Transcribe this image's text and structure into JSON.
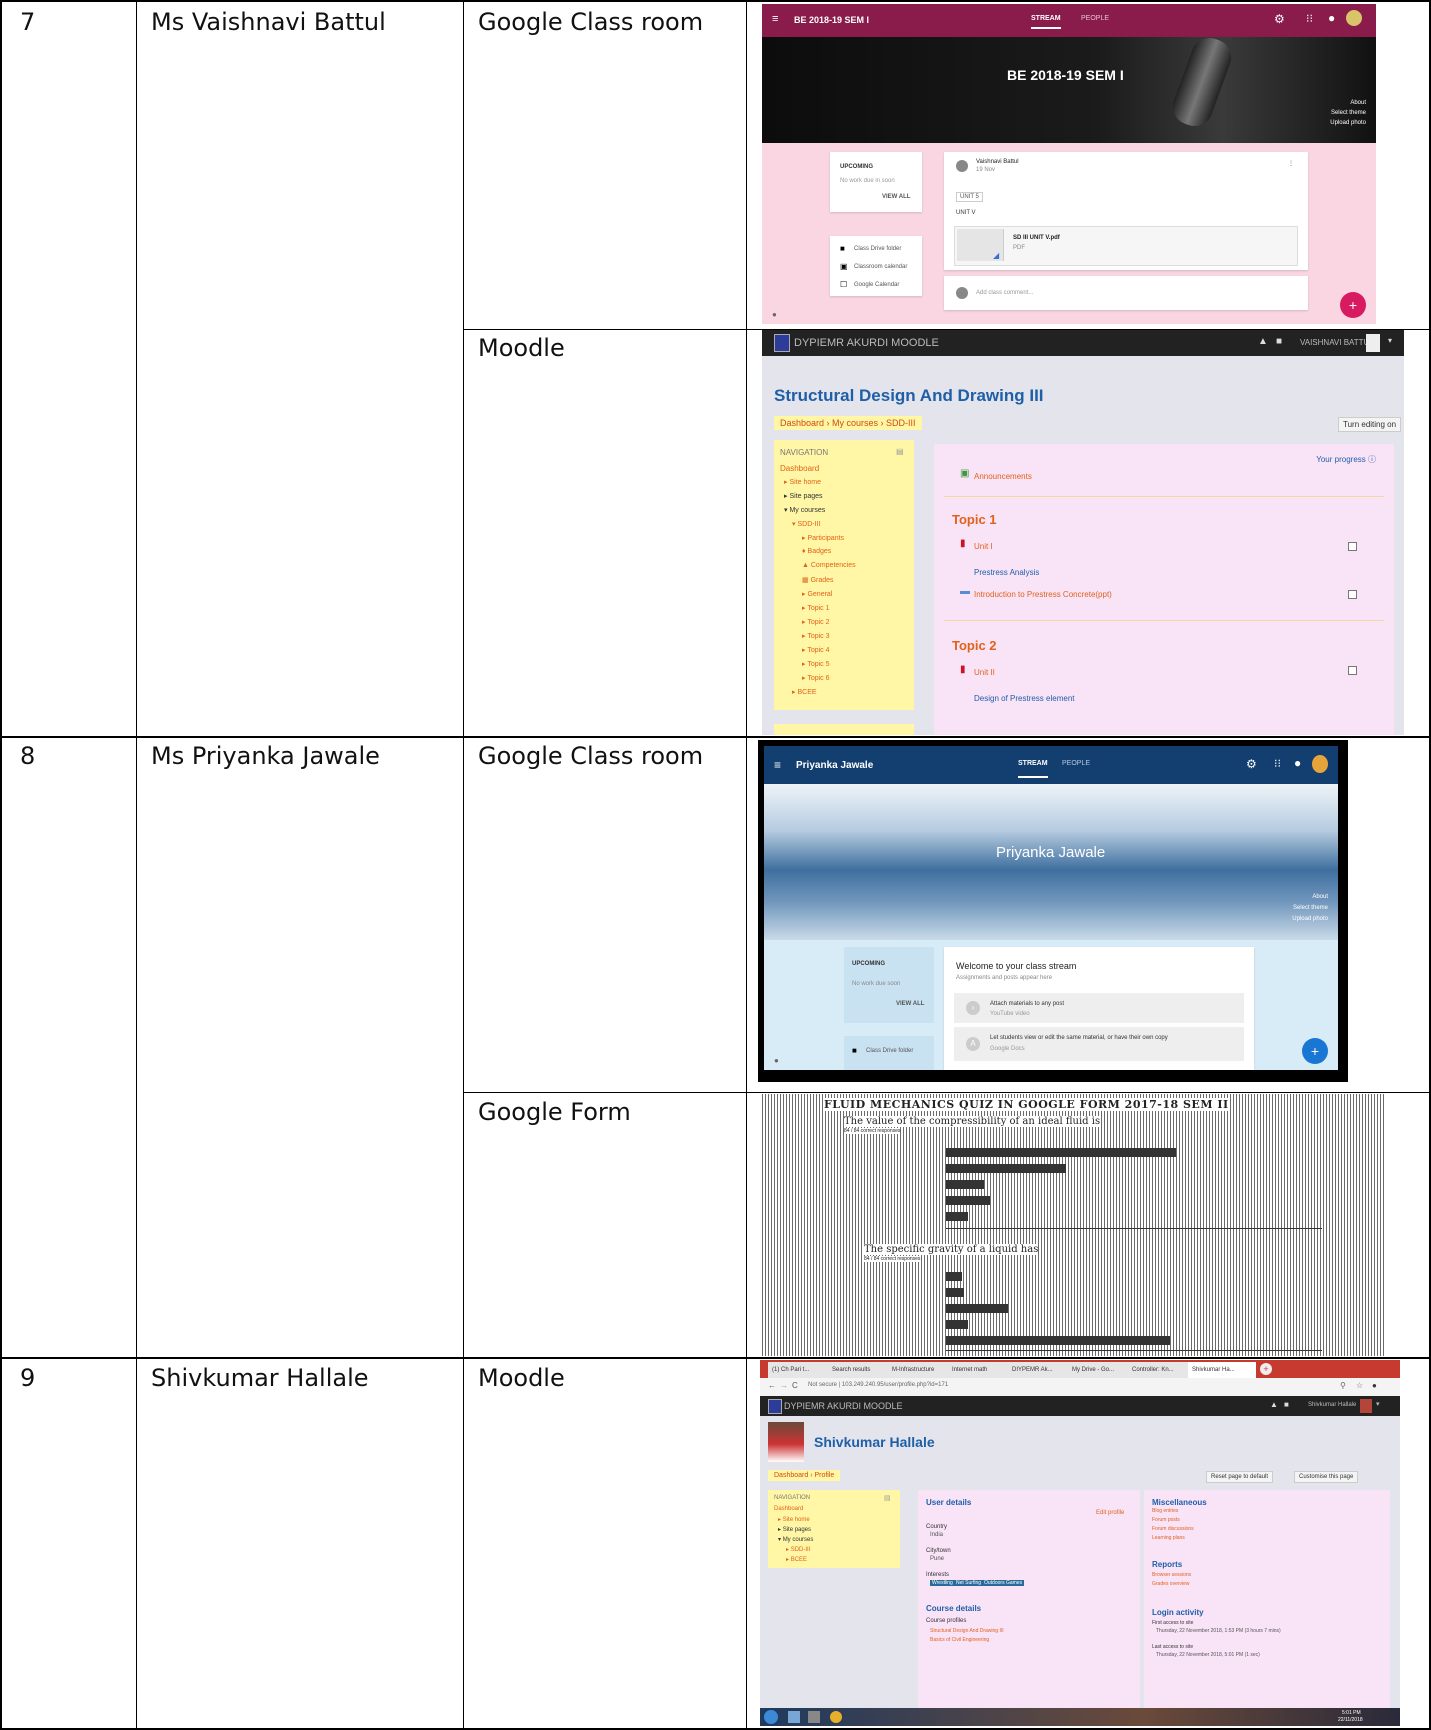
{
  "rows": [
    {
      "no": "7",
      "name": "Ms Vaishnavi Battul",
      "tools": [
        "Google Class room",
        "Moodle"
      ]
    },
    {
      "no": "8",
      "name": "Ms Priyanka Jawale",
      "tools": [
        "Google Class room",
        "Google Form"
      ]
    },
    {
      "no": "9",
      "name": "Shivkumar Hallale",
      "tools": [
        "Moodle"
      ]
    }
  ],
  "gc1": {
    "title": "BE 2018-19 SEM I",
    "tab_stream": "STREAM",
    "tab_people": "PEOPLE",
    "banner_title": "BE 2018-19 SEM I",
    "about": "About",
    "select_theme": "Select theme",
    "upload_photo": "Upload photo",
    "upcoming": "UPCOMING",
    "no_work": "No work due in soon",
    "view_all": "VIEW ALL",
    "drive": "Class Drive folder",
    "calendar": "Classroom calendar",
    "gcal": "Google Calendar",
    "poster": "Vaishnavi Battul",
    "post_time": "19 Nov",
    "unit_chip": "UNIT 5",
    "unit_text": "UNIT V",
    "file_name": "SD III UNIT V.pdf",
    "file_type": "PDF",
    "add_comment": "Add class comment..."
  },
  "moodle1": {
    "site": "DYPIEMR AKURDI MOODLE",
    "user": "VAISHNAVI BATTUL",
    "course_title": "Structural Design And Drawing III",
    "breadcrumb": "Dashboard  ›  My courses  ›  SDD-III",
    "turn_editing": "Turn editing on",
    "nav_heading": "NAVIGATION",
    "nav": [
      "Dashboard",
      "Site home",
      "Site pages",
      "My courses",
      "SDD-III",
      "Participants",
      "Badges",
      "Competencies",
      "Grades",
      "General",
      "Topic 1",
      "Topic 2",
      "Topic 3",
      "Topic 4",
      "Topic 5",
      "Topic 6",
      "BCEE"
    ],
    "progress": "Your progress",
    "announcements": "Announcements",
    "topic1": "Topic 1",
    "unit1": "Unit I",
    "unit1_desc": "Prestress Analysis",
    "intro": "Introduction to Prestress Concrete(ppt)",
    "topic2": "Topic 2",
    "unit2": "Unit II",
    "unit2_desc": "Design of Prestress element"
  },
  "gc2": {
    "title": "Priyanka Jawale",
    "tab_stream": "STREAM",
    "tab_people": "PEOPLE",
    "banner_title": "Priyanka Jawale",
    "about": "About",
    "select_theme": "Select theme",
    "upload_photo": "Upload photo",
    "upcoming": "UPCOMING",
    "no_work": "No work due soon",
    "view_all": "VIEW ALL",
    "drive": "Class Drive folder",
    "welcome": "Welcome to your class stream",
    "welcome_sub": "Assignments and posts appear here",
    "tip1": "Attach materials to any post",
    "tip1_sub": "YouTube video",
    "tip2": "Let students view or edit the same material, or have their own copy",
    "tip2_sub": "Google Docs"
  },
  "gform": {
    "title": "FLUID MECHANICS QUIZ IN GOOGLE FORM 2017-18 SEM II",
    "q1": "The value of the compressibility of an ideal fluid is",
    "q1_sub": "84 / 84 correct responses",
    "q2": "The specific gravity of a liquid has",
    "q2_sub": "84 / 84 correct responses"
  },
  "moodle2": {
    "tabs": [
      "(1) Ch Pari t...",
      "Search results",
      "M-Infrastructure",
      "Internet math",
      "DIYPEMR Ak...",
      "My Drive - Go...",
      "Controller: Kn...",
      "Shivkumar Ha..."
    ],
    "url": "Not secure  |  103.249.240.95/user/profile.php?id=171",
    "site": "DYPIEMR AKURDI MOODLE",
    "user": "Shivkumar Hallale",
    "name": "Shivkumar Hallale",
    "breadcrumb": "Dashboard  ›  Profile",
    "reset": "Reset page to default",
    "customise": "Customise this page",
    "nav_heading": "NAVIGATION",
    "nav": [
      "Dashboard",
      "Site home",
      "Site pages",
      "My courses",
      "SDD-III",
      "BCEE"
    ],
    "user_details": "User details",
    "edit_profile": "Edit profile",
    "country_label": "Country",
    "country": "India",
    "city_label": "City/town",
    "city": "Pune",
    "interests_label": "Interests",
    "interests": [
      "Wrestling",
      "Net Surfing",
      "Outdoors Games"
    ],
    "misc": "Miscellaneous",
    "misc_links": [
      "Blog entries",
      "Forum posts",
      "Forum discussions",
      "Learning plans"
    ],
    "reports": "Reports",
    "report_links": [
      "Browser sessions",
      "Grades overview"
    ],
    "course_details": "Course details",
    "course_profiles": "Course profiles",
    "courses": [
      "Structural Design And Drawing III",
      "Basics of Civil Engineering"
    ],
    "login_activity": "Login activity",
    "first_access": "First access to site",
    "first_access_val": "Thursday, 22 November 2018, 1:53 PM  (3 hours 7 mins)",
    "last_access": "Last access to site",
    "last_access_val": "Thursday, 22 November 2018, 5:01 PM  (1 sec)",
    "clock": "5:01 PM",
    "date": "22/11/2018"
  },
  "colors": {
    "gc1_header": "#8a1c4b",
    "gc1_bg": "#f9d6e1",
    "moodle_nav": "#fff7a5",
    "moodle_main": "#f9e3f7",
    "gc2_header": "#123f70",
    "fab_pink": "#d81b60",
    "fab_blue": "#1976d2"
  }
}
